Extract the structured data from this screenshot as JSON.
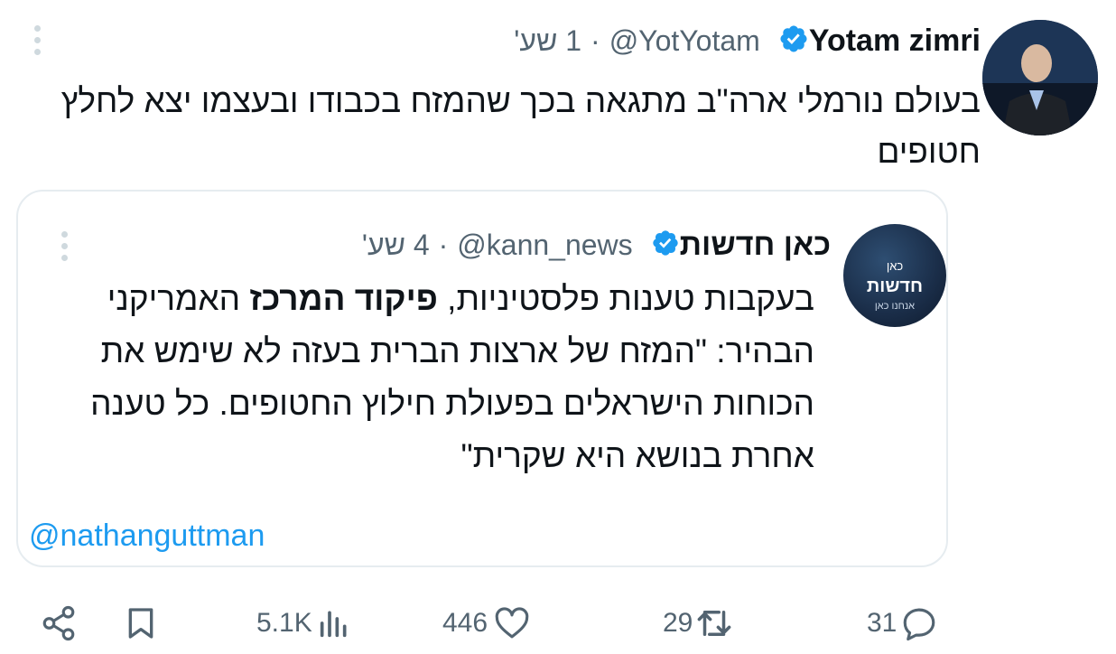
{
  "tweet": {
    "author_name": "Yotam zimri",
    "handle": "@YotYotam",
    "separator": "·",
    "time": "1 שע'",
    "text": "בעולם נורמלי ארה\"ב מתגאה בכך שהמזח בכבודו ובעצמו יצא לחלץ חטופים"
  },
  "quoted": {
    "author_name": "כאן חדשות",
    "handle": "@kann_news",
    "separator": "·",
    "time": "4 שע'",
    "text_before": "בעקבות טענות פלסטיניות, ",
    "text_bold": "פיקוד המרכז",
    "text_after": " האמריקני הבהיר: \"המזח של ארצות הברית בעזה לא שימש את הכוחות הישראלים בפעולת חילוץ החטופים. כל טענה אחרת בנושא היא שקרית\"",
    "mention": "@nathanguttman",
    "avatar_logo_line1": "כאן",
    "avatar_logo_line2": "חדשות",
    "avatar_logo_line3": "אנחנו כאן"
  },
  "actions": {
    "views": "5.1K",
    "likes": "446",
    "retweets": "29",
    "replies": "31"
  },
  "colors": {
    "verified": "#1d9bf0",
    "link": "#1d9bf0",
    "muted": "#536471"
  }
}
